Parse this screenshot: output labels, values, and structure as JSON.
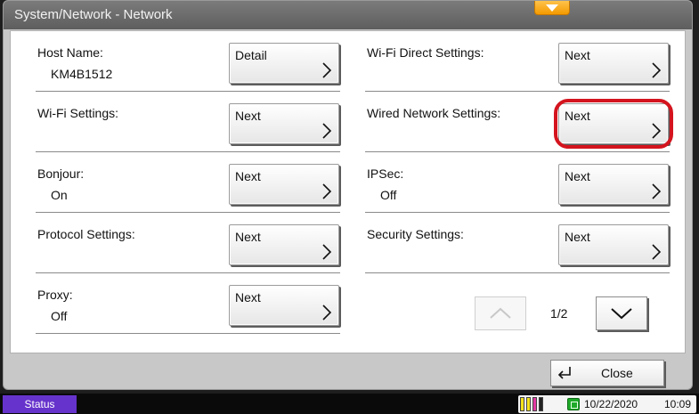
{
  "window": {
    "title": "System/Network - Network",
    "expand_icon": "triangle-down-icon",
    "accent_color": "#f39a00"
  },
  "left_items": [
    {
      "label": "Host Name:",
      "value": "KM4B1512",
      "button_label": "Detail"
    },
    {
      "label": "Wi-Fi Settings:",
      "value": "",
      "button_label": "Next"
    },
    {
      "label": "Bonjour:",
      "value": "On",
      "button_label": "Next"
    },
    {
      "label": "Protocol Settings:",
      "value": "",
      "button_label": "Next"
    },
    {
      "label": "Proxy:",
      "value": "Off",
      "button_label": "Next"
    }
  ],
  "right_items": [
    {
      "label": "Wi-Fi Direct Settings:",
      "value": "",
      "button_label": "Next"
    },
    {
      "label": "Wired Network Settings:",
      "value": "",
      "button_label": "Next",
      "highlighted": true
    },
    {
      "label": "IPSec:",
      "value": "Off",
      "button_label": "Next"
    },
    {
      "label": "Security Settings:",
      "value": "",
      "button_label": "Next"
    }
  ],
  "highlight_color": "#d4141e",
  "pagination": {
    "page_indicator": "1/2",
    "up_enabled": false,
    "down_enabled": true
  },
  "footer": {
    "close_label": "Close",
    "close_icon": "return-arrow-icon"
  },
  "status_bar": {
    "status_label": "Status",
    "status_color": "#6633cc",
    "toner_colors": [
      "#f5e21b",
      "#f5e21b",
      "#e23aa3",
      "#222222"
    ],
    "memory_icon": "memory-card-icon",
    "date": "10/22/2020",
    "time": "10:09"
  }
}
